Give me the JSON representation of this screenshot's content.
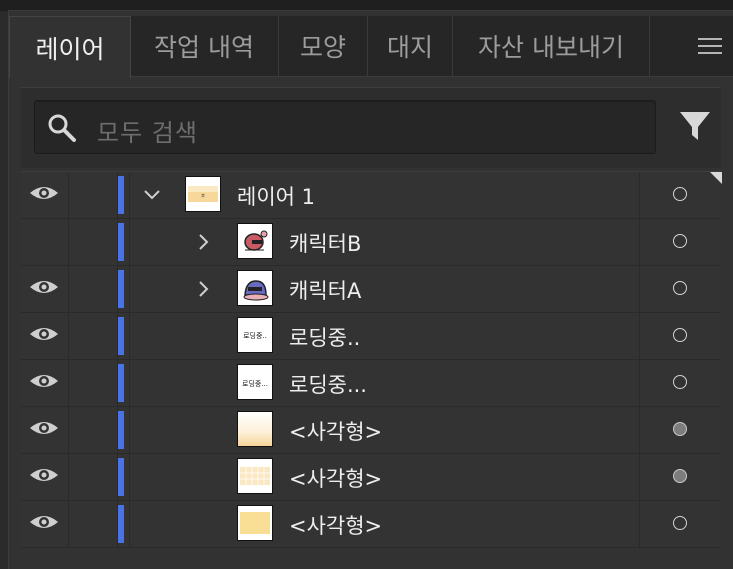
{
  "tabs": [
    {
      "label": "레이어",
      "active": true
    },
    {
      "label": "작업 내역",
      "active": false
    },
    {
      "label": "모양",
      "active": false
    },
    {
      "label": "대지",
      "active": false
    },
    {
      "label": "자산 내보내기",
      "active": false
    }
  ],
  "search": {
    "placeholder": "모두 검색"
  },
  "colors": {
    "layer_color": "#4b73e8",
    "panel_bg": "#323232",
    "row_bg": "#333333"
  },
  "layers": [
    {
      "name": "레이어 1",
      "visible": true,
      "expanded": true,
      "has_children": true,
      "level": 0,
      "target": "empty",
      "thumb": "layer"
    },
    {
      "name": "캐릭터B",
      "visible": false,
      "expanded": false,
      "has_children": true,
      "level": 1,
      "target": "empty",
      "thumb": "charB"
    },
    {
      "name": "캐릭터A",
      "visible": true,
      "expanded": false,
      "has_children": true,
      "level": 1,
      "target": "empty",
      "thumb": "charA"
    },
    {
      "name": "로딩중..",
      "visible": true,
      "expanded": false,
      "has_children": false,
      "level": 1,
      "target": "empty",
      "thumb": "text1"
    },
    {
      "name": "로딩중...",
      "visible": true,
      "expanded": false,
      "has_children": false,
      "level": 1,
      "target": "empty",
      "thumb": "text2"
    },
    {
      "name": "<사각형>",
      "visible": true,
      "expanded": false,
      "has_children": false,
      "level": 1,
      "target": "filled",
      "thumb": "grad"
    },
    {
      "name": "<사각형>",
      "visible": true,
      "expanded": false,
      "has_children": false,
      "level": 1,
      "target": "filled",
      "thumb": "grid"
    },
    {
      "name": "<사각형>",
      "visible": true,
      "expanded": false,
      "has_children": false,
      "level": 1,
      "target": "empty",
      "thumb": "solid"
    }
  ],
  "thumb_text": {
    "text1": "로딩중..",
    "text2": "로딩중...",
    "layer": "ㅊ"
  }
}
